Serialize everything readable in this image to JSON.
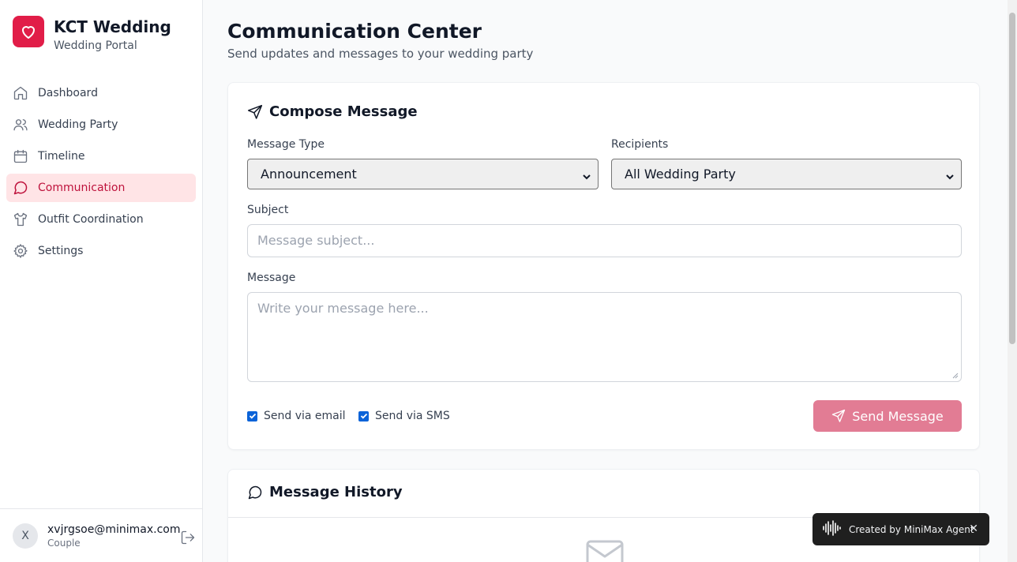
{
  "brand": {
    "title": "KCT Wedding",
    "subtitle": "Wedding Portal",
    "accent": "#e11d48"
  },
  "sidebar": {
    "items": [
      {
        "label": "Dashboard",
        "icon": "home-icon",
        "active": false
      },
      {
        "label": "Wedding Party",
        "icon": "users-icon",
        "active": false
      },
      {
        "label": "Timeline",
        "icon": "calendar-icon",
        "active": false
      },
      {
        "label": "Communication",
        "icon": "message-circle-icon",
        "active": true
      },
      {
        "label": "Outfit Coordination",
        "icon": "shirt-icon",
        "active": false
      },
      {
        "label": "Settings",
        "icon": "gear-icon",
        "active": false
      }
    ]
  },
  "user": {
    "initial": "X",
    "email": "xvjrgsoe@minimax.com",
    "role": "Couple"
  },
  "page": {
    "title": "Communication Center",
    "subtitle": "Send updates and messages to your wedding party"
  },
  "compose": {
    "title": "Compose Message",
    "message_type_label": "Message Type",
    "message_type_value": "Announcement",
    "recipients_label": "Recipients",
    "recipients_value": "All Wedding Party",
    "subject_label": "Subject",
    "subject_placeholder": "Message subject...",
    "message_label": "Message",
    "message_placeholder": "Write your message here...",
    "send_email_label": "Send via email",
    "send_email_checked": true,
    "send_sms_label": "Send via SMS",
    "send_sms_checked": true,
    "send_button": "Send Message"
  },
  "history": {
    "title": "Message History"
  },
  "toast": {
    "text": "Created by MiniMax Agent",
    "close": "✕"
  }
}
